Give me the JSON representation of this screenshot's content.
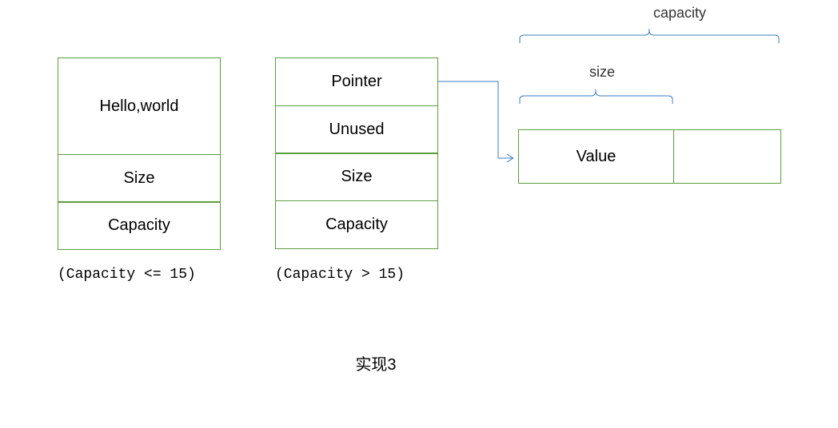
{
  "left_stack": {
    "cell1": "Hello,world",
    "cell2": "Size",
    "cell3": "Capacity",
    "caption": "(Capacity <= 15)"
  },
  "mid_stack": {
    "cell1": "Pointer",
    "cell2": "Unused",
    "cell3": "Size",
    "cell4": "Capacity",
    "caption": "(Capacity > 15)"
  },
  "heap": {
    "capacity_label": "capacity",
    "size_label": "size",
    "value_label": "Value"
  },
  "title": "实现3"
}
